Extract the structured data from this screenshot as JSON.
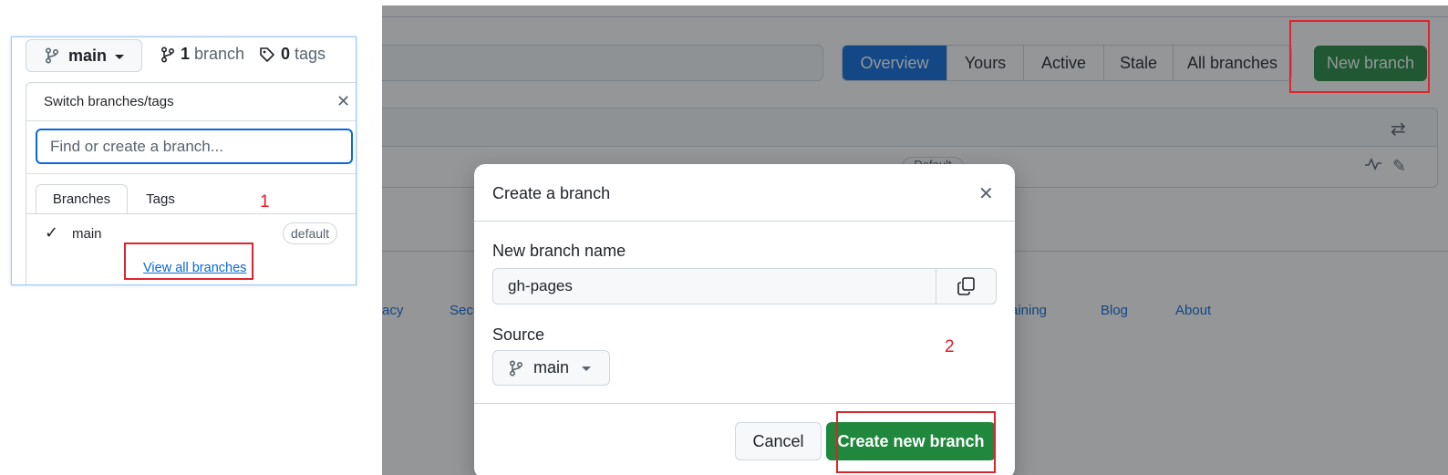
{
  "left_panel": {
    "branch_button": {
      "label": "main"
    },
    "branch_count": {
      "count": "1",
      "label": "branch"
    },
    "tag_count": {
      "count": "0",
      "label": "tags"
    },
    "dropdown": {
      "title": "Switch branches/tags",
      "close_icon": "close-icon",
      "search_placeholder": "Find or create a branch...",
      "tabs": [
        {
          "label": "Branches",
          "active": true
        },
        {
          "label": "Tags",
          "active": false
        }
      ],
      "branches": [
        {
          "name": "main",
          "selected": true,
          "badge": "default"
        }
      ],
      "view_all_link": "View all branches"
    },
    "step_annotation": "1"
  },
  "right_panel": {
    "filter_tabs": [
      {
        "label": "Overview",
        "active": true
      },
      {
        "label": "Yours",
        "active": false
      },
      {
        "label": "Active",
        "active": false
      },
      {
        "label": "Stale",
        "active": false
      },
      {
        "label": "All branches",
        "active": false
      }
    ],
    "new_branch_button": "New branch",
    "partial_badge": "Default",
    "footer_links": [
      "acy",
      "Secu",
      "raining",
      "Blog",
      "About"
    ],
    "modal": {
      "title": "Create a branch",
      "name_label": "New branch name",
      "name_value": "gh-pages",
      "source_label": "Source",
      "source_value": "main",
      "cancel_label": "Cancel",
      "create_label": "Create new branch"
    },
    "step_annotation": "2"
  },
  "colors": {
    "primary_green": "#1f883d",
    "accent_blue": "#0969da",
    "annotation_red": "#d9262f"
  }
}
